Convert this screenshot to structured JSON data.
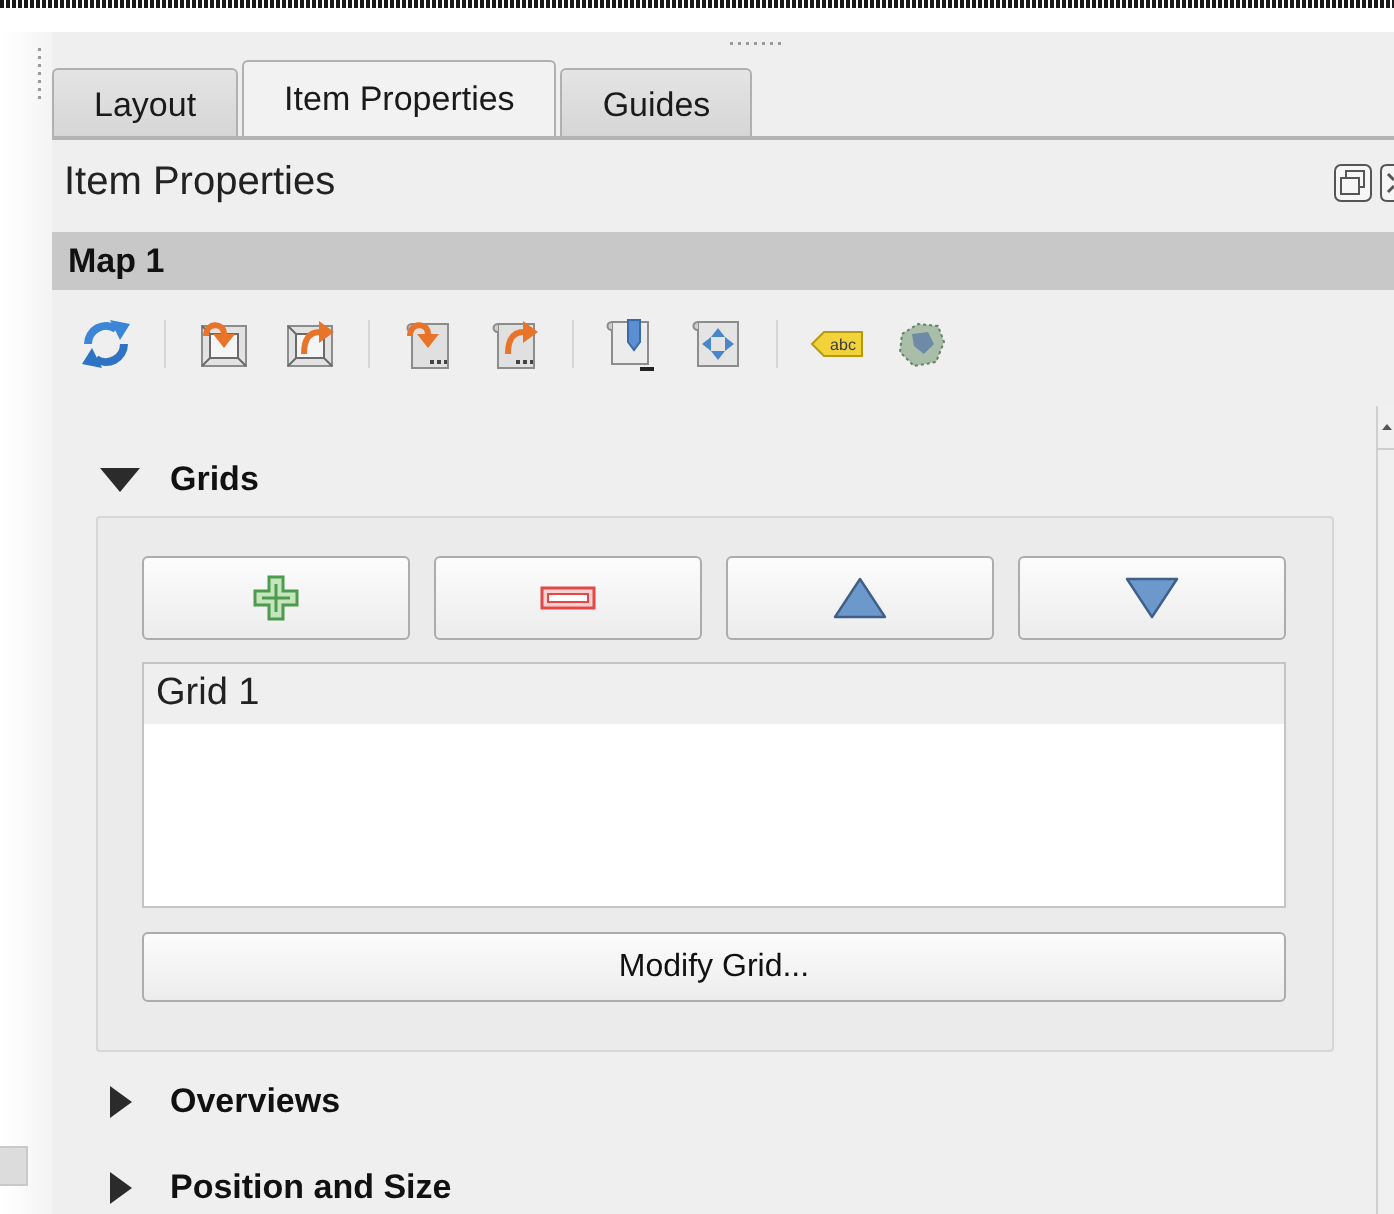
{
  "tabs": [
    {
      "label": "Layout",
      "selected": false
    },
    {
      "label": "Item Properties",
      "selected": true
    },
    {
      "label": "Guides",
      "selected": false
    }
  ],
  "panel": {
    "title": "Item Properties"
  },
  "item_header": {
    "title": "Map 1"
  },
  "toolbar": [
    {
      "kind": "refresh"
    },
    {
      "kind": "separator"
    },
    {
      "kind": "page_down"
    },
    {
      "kind": "page_right"
    },
    {
      "kind": "separator"
    },
    {
      "kind": "atlas_down"
    },
    {
      "kind": "atlas_right"
    },
    {
      "kind": "separator"
    },
    {
      "kind": "pin"
    },
    {
      "kind": "move"
    },
    {
      "kind": "separator"
    },
    {
      "kind": "label",
      "text": "abc"
    },
    {
      "kind": "tint"
    }
  ],
  "sections": [
    {
      "title": "Grids",
      "expanded": true,
      "buttons": [
        {
          "kind": "add"
        },
        {
          "kind": "remove"
        },
        {
          "kind": "up"
        },
        {
          "kind": "down"
        }
      ],
      "items": [
        {
          "label": "Grid 1",
          "selected": true
        }
      ],
      "action": "Modify Grid..."
    },
    {
      "title": "Overviews",
      "expanded": false
    },
    {
      "title": "Position and Size",
      "expanded": false
    }
  ]
}
